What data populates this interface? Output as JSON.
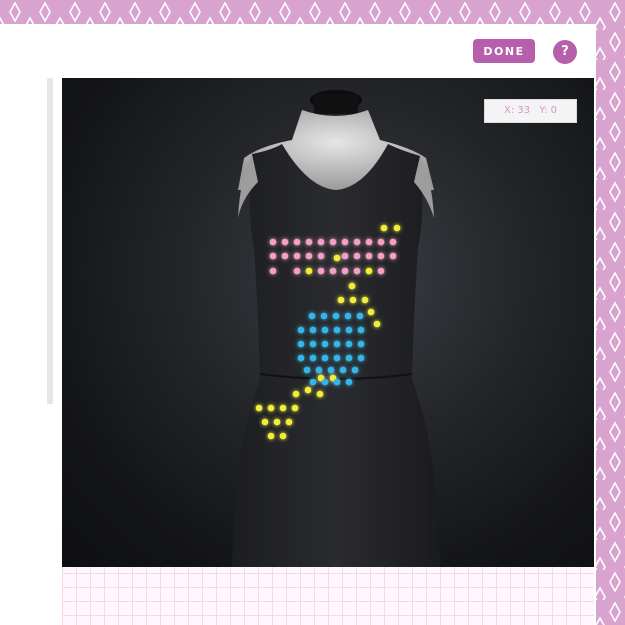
{
  "toolbar": {
    "done_label": "DONE",
    "help_label": "?"
  },
  "coordinates": {
    "x_label": "X: 33",
    "y_label": "Y: 0"
  },
  "colors": {
    "background_pink": "#d8a3cf",
    "accent_purple": "#b65fab",
    "led_pink": "#f2a0c4",
    "led_yellow": "#f1ee3a",
    "led_blue": "#35b6e8",
    "grid_line": "#f3d9ec"
  },
  "icons": [
    "diamond-pattern",
    "mannequin",
    "help-icon"
  ],
  "led_pattern": {
    "pink_rows": 3,
    "colors_used": [
      "pink",
      "yellow",
      "blue"
    ]
  }
}
